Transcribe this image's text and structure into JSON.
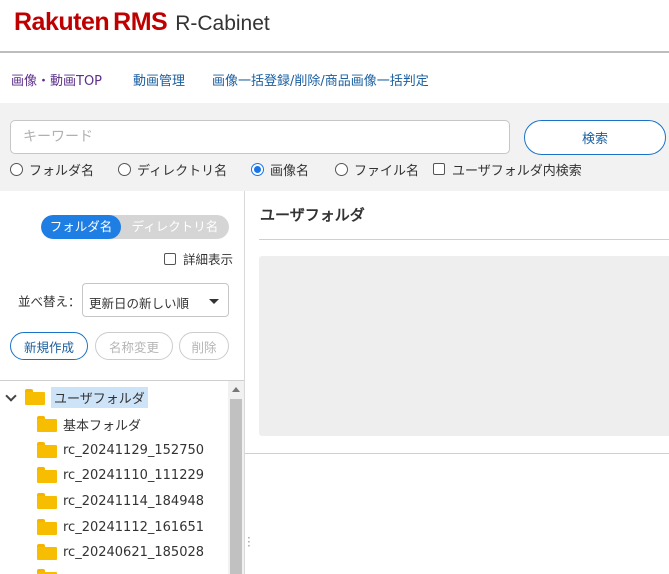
{
  "header": {
    "brand": "Rakuten",
    "brand_suffix": "RMS",
    "product": "R-Cabinet",
    "brand_color": "#bf0000"
  },
  "nav": {
    "links": [
      {
        "label": "画像・動画TOP"
      },
      {
        "label": "動画管理"
      },
      {
        "label": "画像一括登録/削除/商品画像一括判定"
      }
    ]
  },
  "search": {
    "placeholder": "キーワード",
    "value": "",
    "button_label": "検索",
    "options": [
      {
        "label": "フォルダ名",
        "type": "radio",
        "checked": false
      },
      {
        "label": "ディレクトリ名",
        "type": "radio",
        "checked": false
      },
      {
        "label": "画像名",
        "type": "radio",
        "checked": true
      },
      {
        "label": "ファイル名",
        "type": "radio",
        "checked": false
      },
      {
        "label": "ユーザフォルダ内検索",
        "type": "checkbox",
        "checked": false
      }
    ]
  },
  "sidebar": {
    "toggle": {
      "active": "フォルダ名",
      "inactive": "ディレクトリ名"
    },
    "detail_label": "詳細表示",
    "sort_label": "並べ替え：",
    "sort_value": "更新日の新しい順",
    "buttons": {
      "create": "新規作成",
      "rename": "名称変更",
      "delete": "削除"
    },
    "tree": {
      "root": "ユーザフォルダ",
      "children": [
        "基本フォルダ",
        "rc_20241129_152750",
        "rc_20241110_111229",
        "rc_20241114_184948",
        "rc_20241112_161651",
        "rc_20240621_185028"
      ]
    }
  },
  "main": {
    "title": "ユーザフォルダ"
  },
  "colors": {
    "accent": "#1f7ee3",
    "link": "#1a5fa0",
    "visited_link": "#5c2f8a",
    "folder": "#f7bd00",
    "selection": "#cde3f7"
  }
}
